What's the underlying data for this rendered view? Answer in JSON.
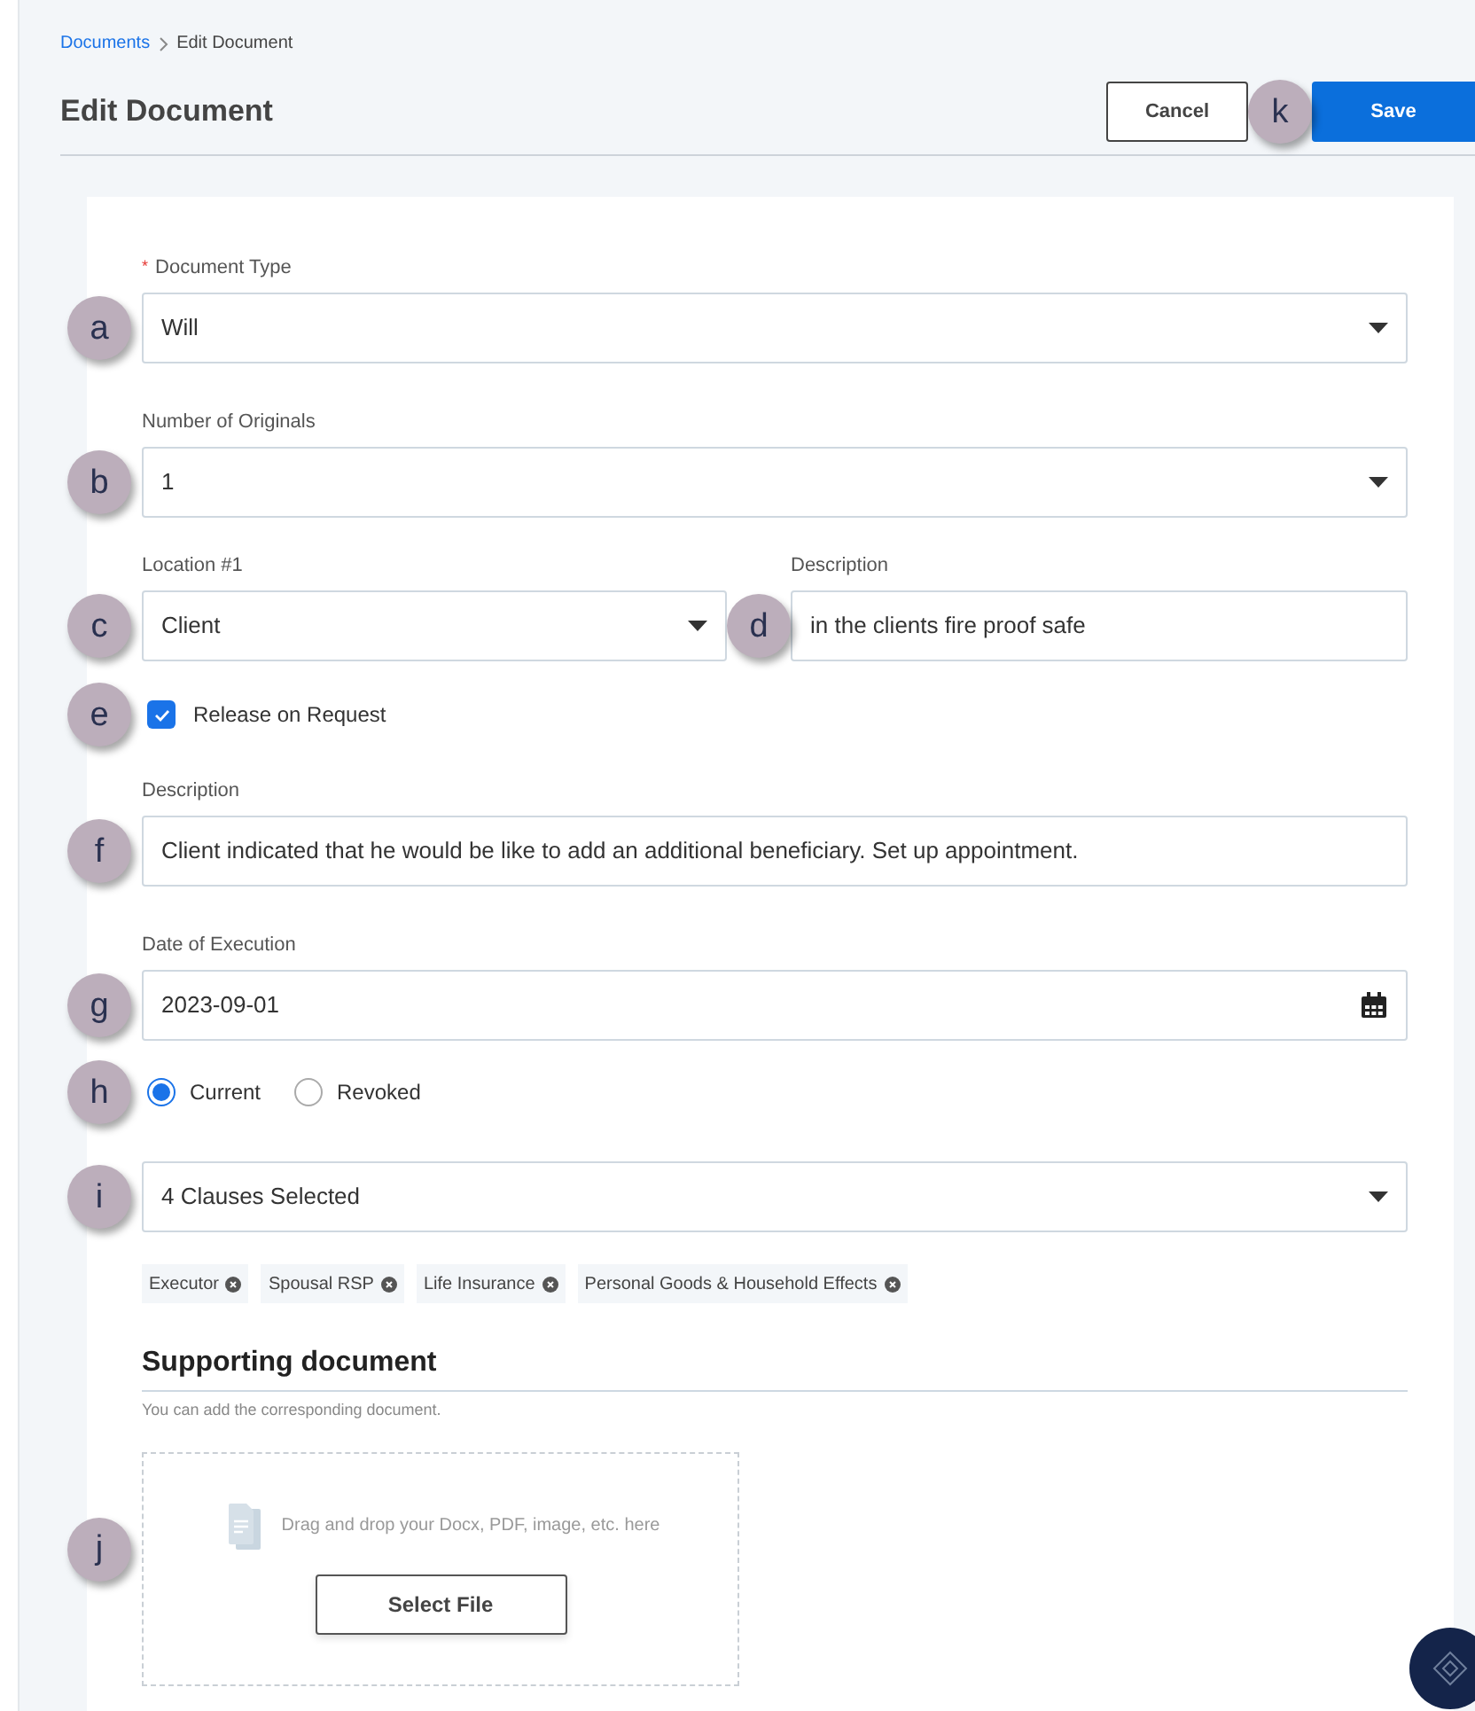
{
  "breadcrumb": [
    {
      "label": "Documents",
      "link": true
    },
    {
      "label": "Edit Document",
      "link": false
    }
  ],
  "header": {
    "title": "Edit Document",
    "cancel": "Cancel",
    "save": "Save",
    "callout": "k"
  },
  "form": [
    {
      "kind": "select",
      "callout": "a",
      "label": "Document Type",
      "required_mark": "*",
      "value": "Will"
    },
    {
      "kind": "select",
      "callout": "b",
      "label": "Number of Originals",
      "value": "1"
    },
    {
      "kind": "pair",
      "callout": "c",
      "callout_2": "d",
      "left": {
        "label": "Location #1",
        "value": "Client"
      },
      "right": {
        "label": "Description",
        "value": "in the clients fire proof safe"
      }
    },
    {
      "kind": "checkbox",
      "callout": "e",
      "label": "Release on Request",
      "checked": true
    },
    {
      "kind": "input",
      "callout": "f",
      "label": "Description",
      "value": "Client indicated that he would be like to add an additional beneficiary.  Set up appointment."
    },
    {
      "kind": "date",
      "callout": "g",
      "label": "Date of Execution",
      "value": "2023-09-01"
    },
    {
      "kind": "radio",
      "callout": "h",
      "options": [
        {
          "label": "Current",
          "selected": true
        },
        {
          "label": "Revoked",
          "selected": false
        }
      ]
    },
    {
      "kind": "multiselect",
      "callout": "i",
      "value": "4 Clauses Selected",
      "chips": [
        "Executor",
        "Spousal RSP",
        "Life Insurance",
        "Personal Goods & Household Effects"
      ]
    }
  ],
  "supporting": {
    "title": "Supporting document",
    "subtitle": "You can add the corresponding document.",
    "callout": "j",
    "drop_text": "Drag and drop your Docx, PDF, image, etc. here",
    "button": "Select File"
  }
}
